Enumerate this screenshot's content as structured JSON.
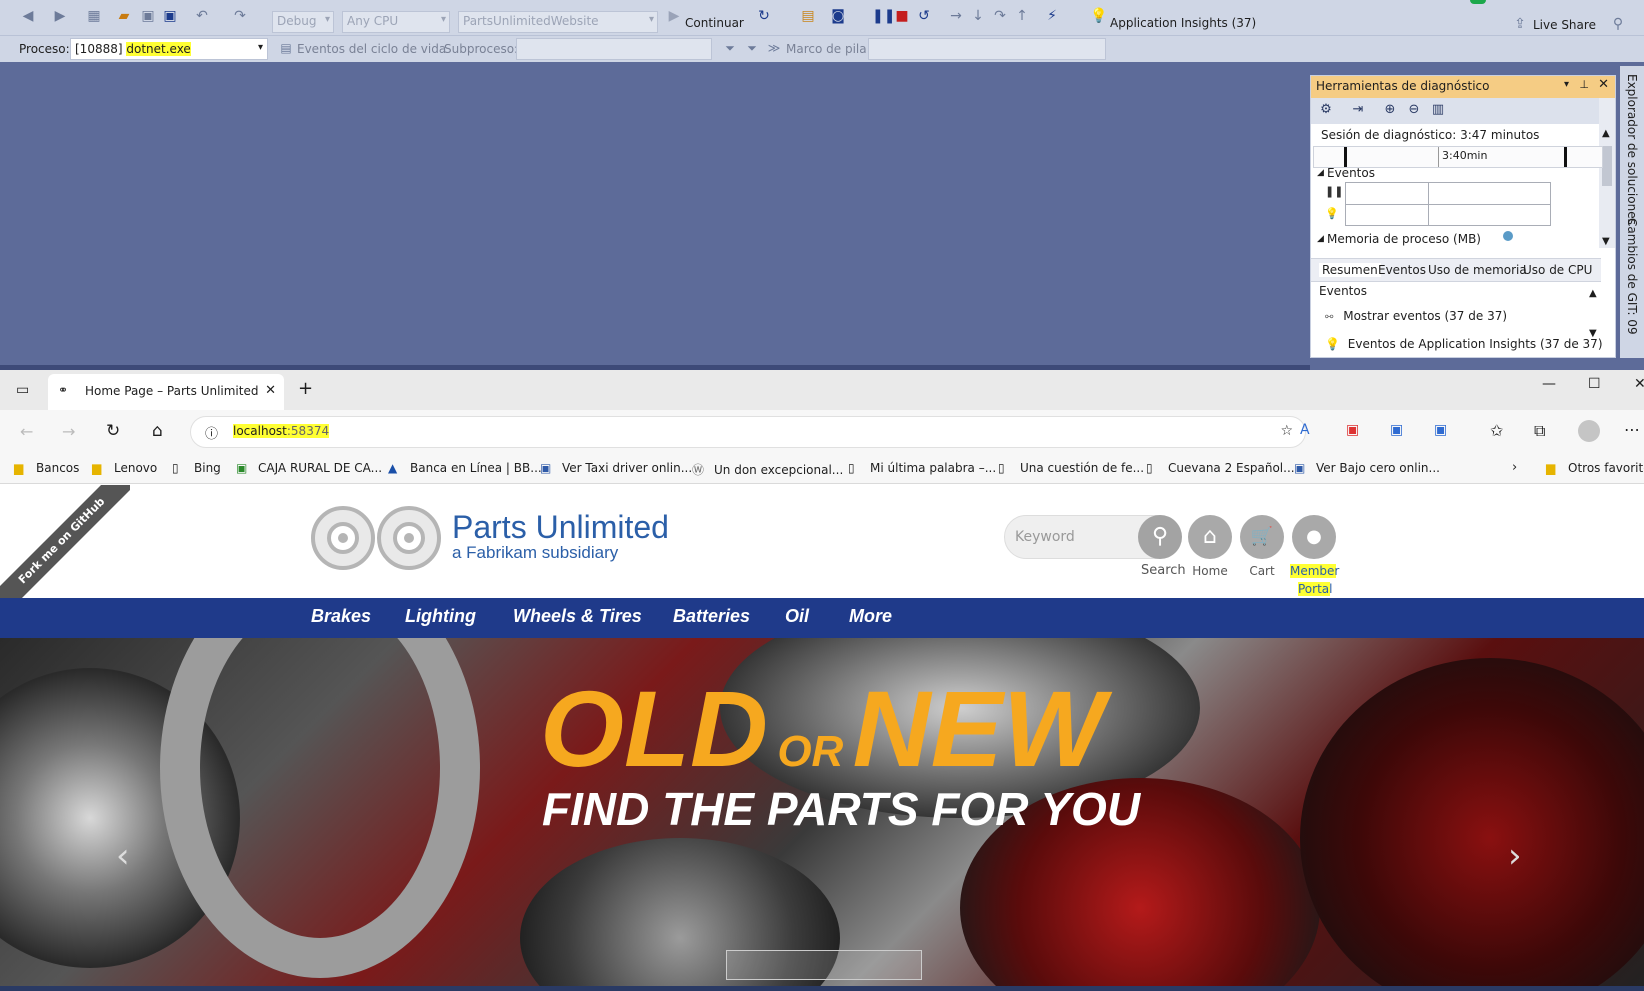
{
  "vs": {
    "toolbar": {
      "config": "Debug",
      "platform": "Any CPU",
      "project": "PartsUnlimitedWebsite",
      "continue_label": "Continuar",
      "app_insights": "Application Insights (37)",
      "live_share": "Live Share"
    },
    "debug_bar": {
      "process_label": "Proceso:",
      "process_pid": "[10888] ",
      "process_name": "dotnet.exe",
      "lifecycle": "Eventos del ciclo de vida",
      "thread_label": "Subproceso:",
      "stack_label": "Marco de pila:"
    },
    "diag": {
      "title": "Herramientas de diagnóstico",
      "session": "Sesión de diagnóstico: 3:47 minutos",
      "timeline_tick": "3:40min",
      "events_section": "Eventos",
      "memory_section": "Memoria de proceso (MB)",
      "tabs": [
        "Resumen",
        "Eventos",
        "Uso de memoria",
        "Uso de CPU"
      ],
      "events_heading": "Eventos",
      "items": [
        "Mostrar eventos (37 de 37)",
        "Eventos de Application Insights (37 de 37)"
      ]
    },
    "side_tabs": [
      "Explorador de soluciones",
      "Cambios de GIT: 09"
    ]
  },
  "browser": {
    "tab_title": "Home Page – Parts Unlimited",
    "url_host": "localhost",
    "url_port": ":58374",
    "favorites": [
      "Bancos",
      "Lenovo",
      "Bing",
      "CAJA RURAL DE CA...",
      "Banca en Línea | BB...",
      "Ver Taxi driver onlin...",
      "Un don excepcional...",
      "Mi última palabra –...",
      "Una cuestión de fe...",
      "Cuevana 2 Español...",
      "Ver Bajo cero onlin..."
    ],
    "other_favs": "Otros favoritos"
  },
  "site": {
    "ribbon": "Fork me on GitHub",
    "brand_name": "Parts Unlimited",
    "brand_sub": "a Fabrikam subsidiary",
    "search_placeholder": "Keyword",
    "icons": [
      "Search",
      "Home",
      "Cart",
      "Member",
      "Portal"
    ],
    "nav": [
      "Brakes",
      "Lighting",
      "Wheels & Tires",
      "Batteries",
      "Oil",
      "More"
    ],
    "hero_old": "OLD",
    "hero_or": "OR",
    "hero_new": "NEW",
    "hero_sub": "FIND THE PARTS FOR YOU"
  },
  "colors": {
    "vs_background": "#5d6b99",
    "diag_title": "#f5cc84",
    "nav_bar": "#1f3a8a",
    "hero_accent": "#f6a81f",
    "highlight": "#ffff33"
  }
}
